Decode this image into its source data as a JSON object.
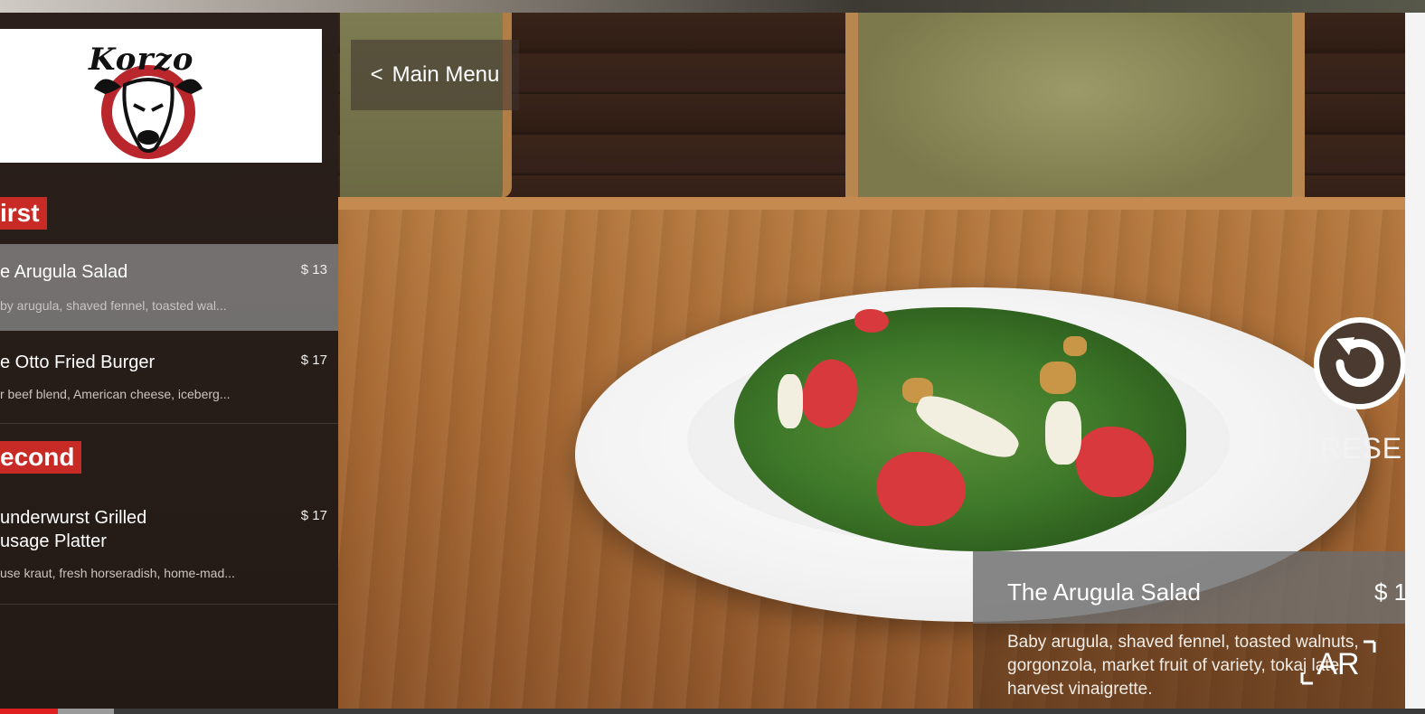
{
  "app": {
    "logo_text": "Korzo"
  },
  "nav": {
    "back_label": "Main Menu",
    "back_glyph": "<"
  },
  "sections": [
    {
      "title": "irst",
      "items": [
        {
          "name": "e Arugula Salad",
          "price": "$ 13",
          "desc": "by arugula, shaved fennel, toasted wal...",
          "selected": true
        },
        {
          "name": "e Otto Fried Burger",
          "price": "$ 17",
          "desc": "r beef blend, American cheese, iceberg..."
        }
      ]
    },
    {
      "title": "econd",
      "items": [
        {
          "name_line1": "underwurst Grilled",
          "name_line2": "usage Platter",
          "price": "$ 17",
          "desc": "use kraut, fresh horseradish, home-mad..."
        }
      ]
    }
  ],
  "reset": {
    "label": "RESE"
  },
  "detail": {
    "title": "The Arugula Salad",
    "price": "$ 1",
    "desc": "Baby arugula, shaved fennel, toasted walnuts, gorgonzola, market fruit of variety, tokaj late harvest vinaigrette."
  },
  "badge": {
    "label": "AR"
  },
  "colors": {
    "accent": "#c82a25",
    "panel_gray": "#6e6e6e",
    "sidebar_bg": "#2b201b"
  },
  "video": {
    "progress_fraction": 0.04
  }
}
